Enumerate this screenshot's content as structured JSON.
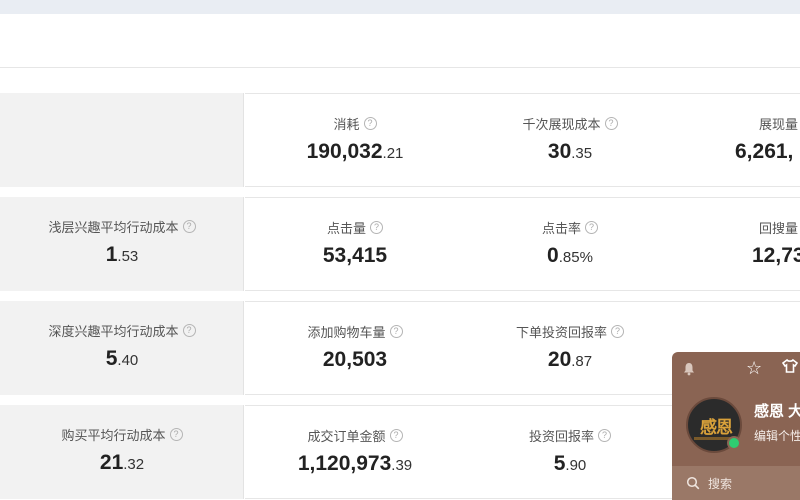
{
  "rows": [
    {
      "left": null,
      "metrics": [
        {
          "label": "消耗",
          "int": "190,032",
          "dec": ".21"
        },
        {
          "label": "千次展现成本",
          "int": "30",
          "dec": ".35"
        },
        {
          "label": "展现量",
          "int": "6,261,",
          "dec": ""
        }
      ]
    },
    {
      "left": {
        "label": "浅层兴趣平均行动成本",
        "int": "1",
        "dec": ".53"
      },
      "metrics": [
        {
          "label": "点击量",
          "int": "53,415",
          "dec": ""
        },
        {
          "label": "点击率",
          "int": "0",
          "dec": ".85%"
        },
        {
          "label": "回搜量",
          "int": "12,73",
          "dec": ""
        }
      ]
    },
    {
      "left": {
        "label": "深度兴趣平均行动成本",
        "int": "5",
        "dec": ".40"
      },
      "metrics": [
        {
          "label": "添加购物车量",
          "int": "20,503",
          "dec": ""
        },
        {
          "label": "下单投资回报率",
          "int": "20",
          "dec": ".87"
        }
      ]
    },
    {
      "left": {
        "label": "购买平均行动成本",
        "int": "21",
        "dec": ".32"
      },
      "metrics": [
        {
          "label": "成交订单金额",
          "int": "1,120,973",
          "dec": ".39"
        },
        {
          "label": "投资回报率",
          "int": "5",
          "dec": ".90"
        }
      ]
    }
  ],
  "help_glyph": "?",
  "widget": {
    "avatar_logo_text": "感恩",
    "name": "感恩 大",
    "signature": "编辑个性",
    "search_placeholder": "搜索",
    "online_color": "#2ecc71",
    "background_color": "#8a6453"
  }
}
